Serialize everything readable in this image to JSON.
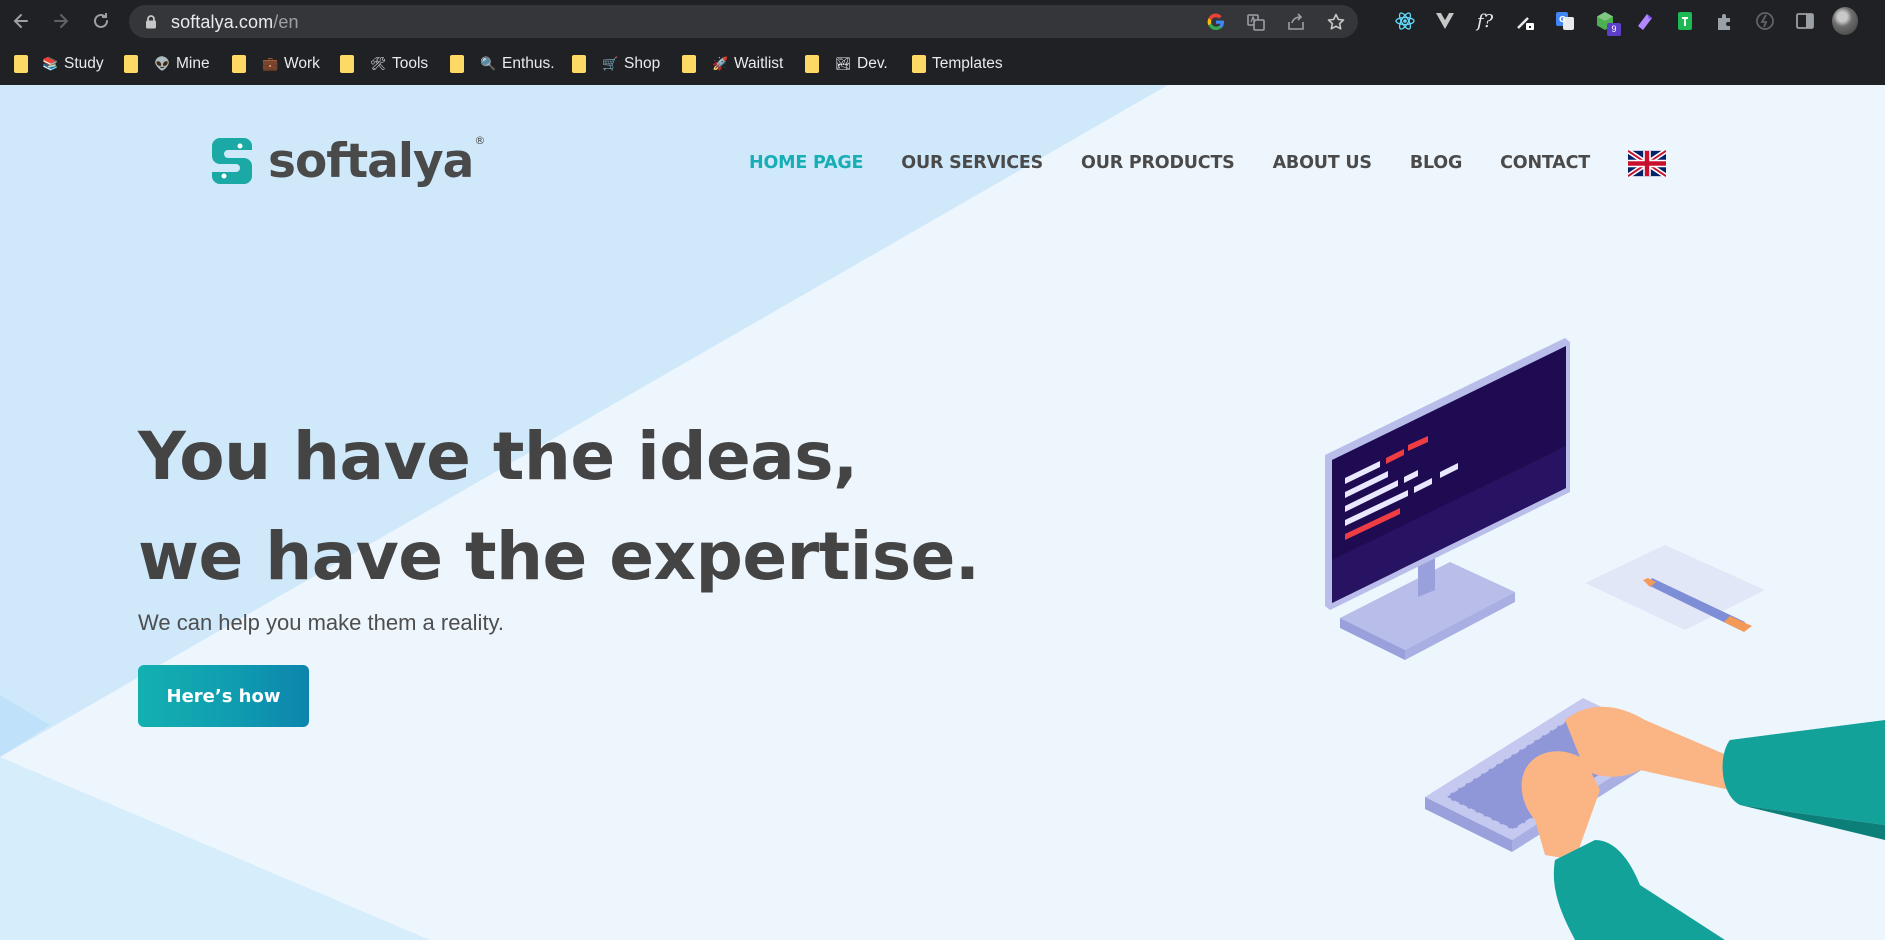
{
  "browser": {
    "url_host": "softalya.com",
    "url_path": "/en",
    "bookmarks": [
      {
        "label": "",
        "emoji": ""
      },
      {
        "label": "Study",
        "emoji": "📚"
      },
      {
        "label": "",
        "emoji": ""
      },
      {
        "label": "Mine",
        "emoji": "👽"
      },
      {
        "label": "",
        "emoji": ""
      },
      {
        "label": "Work",
        "emoji": "💼"
      },
      {
        "label": "",
        "emoji": ""
      },
      {
        "label": "Tools",
        "emoji": "🛠"
      },
      {
        "label": "",
        "emoji": ""
      },
      {
        "label": "Enthus.",
        "emoji": "🔍"
      },
      {
        "label": "",
        "emoji": ""
      },
      {
        "label": "Shop",
        "emoji": "🛒"
      },
      {
        "label": "",
        "emoji": ""
      },
      {
        "label": "Waitlist",
        "emoji": "🚀"
      },
      {
        "label": "",
        "emoji": ""
      },
      {
        "label": "Dev.",
        "emoji": "🏞"
      },
      {
        "label": "Templates",
        "emoji": ""
      }
    ],
    "extension_badge": "9",
    "ext_formula_label": "f?"
  },
  "site": {
    "logo_text": "softalya",
    "logo_reg": "®",
    "nav": [
      {
        "label": "HOME PAGE",
        "active": true
      },
      {
        "label": "OUR SERVICES",
        "active": false
      },
      {
        "label": "OUR PRODUCTS",
        "active": false
      },
      {
        "label": "ABOUT US",
        "active": false
      },
      {
        "label": "BLOG",
        "active": false
      },
      {
        "label": "CONTACT",
        "active": false
      }
    ],
    "hero": {
      "title_line1": "You have the ideas,",
      "title_line2": "we have the expertise.",
      "subtitle": "We can help you make them a reality.",
      "cta_label": "Here’s how"
    },
    "colors": {
      "accent": "#18aeb5",
      "text": "#4a4a4a",
      "background": "#eef6fd",
      "background_shape": "#cfe9fb"
    }
  }
}
